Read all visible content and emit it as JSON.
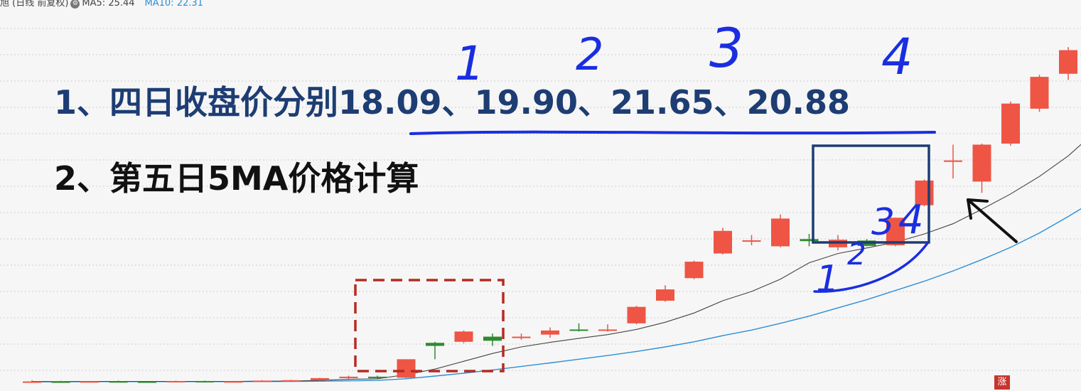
{
  "header": {
    "title_fragment": "旭 (日线 前复权)",
    "ma5_legend": "MA5: 25.44",
    "ma10_legend": "MA10: 22.31",
    "ma10_color": "#2b8fd6"
  },
  "annotations": {
    "line1": "1、四日收盘价分别18.09、19.90、21.65、20.88",
    "line2": "2、第五日5MA价格计算",
    "labels_top": [
      "1",
      "2",
      "3",
      "4"
    ],
    "labels_box": [
      "1",
      "2",
      "3",
      "4"
    ]
  },
  "badge": "涨",
  "colors": {
    "up": "#ee5544",
    "down": "#2f8a2f",
    "ma5": "#444444",
    "ma10": "#2b8fd6",
    "pen": "#1a2ee0",
    "frame_navy": "#1d3d73",
    "dash_red": "#b52b22"
  },
  "chart_data": {
    "type": "candlestick",
    "ylim": [
      10,
      28
    ],
    "grid": true,
    "candles": [
      {
        "o": 10.1,
        "h": 10.18,
        "l": 10.07,
        "c": 10.12
      },
      {
        "o": 10.12,
        "h": 10.15,
        "l": 10.09,
        "c": 10.1
      },
      {
        "o": 10.1,
        "h": 10.14,
        "l": 10.08,
        "c": 10.13
      },
      {
        "o": 10.13,
        "h": 10.16,
        "l": 10.1,
        "c": 10.12
      },
      {
        "o": 10.12,
        "h": 10.14,
        "l": 10.09,
        "c": 10.11
      },
      {
        "o": 10.11,
        "h": 10.16,
        "l": 10.09,
        "c": 10.14
      },
      {
        "o": 10.14,
        "h": 10.16,
        "l": 10.1,
        "c": 10.12
      },
      {
        "o": 10.12,
        "h": 10.15,
        "l": 10.1,
        "c": 10.13
      },
      {
        "o": 10.13,
        "h": 10.18,
        "l": 10.11,
        "c": 10.16
      },
      {
        "o": 10.16,
        "h": 10.2,
        "l": 10.14,
        "c": 10.18
      },
      {
        "o": 10.18,
        "h": 10.3,
        "l": 10.15,
        "c": 10.28
      },
      {
        "o": 10.28,
        "h": 10.4,
        "l": 10.24,
        "c": 10.35
      },
      {
        "o": 10.35,
        "h": 10.4,
        "l": 10.26,
        "c": 10.3
      },
      {
        "o": 10.3,
        "h": 11.2,
        "l": 10.28,
        "c": 11.2
      },
      {
        "o": 12.0,
        "h": 12.05,
        "l": 11.2,
        "c": 11.85
      },
      {
        "o": 12.05,
        "h": 12.6,
        "l": 11.98,
        "c": 12.55
      },
      {
        "o": 12.3,
        "h": 12.45,
        "l": 11.85,
        "c": 12.1
      },
      {
        "o": 12.3,
        "h": 12.45,
        "l": 12.15,
        "c": 12.3
      },
      {
        "o": 12.4,
        "h": 12.75,
        "l": 12.25,
        "c": 12.6
      },
      {
        "o": 12.65,
        "h": 12.95,
        "l": 12.55,
        "c": 12.62
      },
      {
        "o": 12.62,
        "h": 12.9,
        "l": 12.55,
        "c": 12.65
      },
      {
        "o": 12.95,
        "h": 13.8,
        "l": 12.9,
        "c": 13.75
      },
      {
        "o": 14.05,
        "h": 14.8,
        "l": 14.0,
        "c": 14.6
      },
      {
        "o": 15.15,
        "h": 16.0,
        "l": 15.1,
        "c": 15.95
      },
      {
        "o": 16.35,
        "h": 17.6,
        "l": 16.3,
        "c": 17.45
      },
      {
        "o": 16.99,
        "h": 17.25,
        "l": 16.75,
        "c": 16.99
      },
      {
        "o": 16.7,
        "h": 18.25,
        "l": 16.65,
        "c": 18.05
      },
      {
        "o": 17.05,
        "h": 17.3,
        "l": 16.7,
        "c": 16.95
      },
      {
        "o": 16.65,
        "h": 17.25,
        "l": 16.5,
        "c": 17.02
      },
      {
        "o": 16.98,
        "h": 17.05,
        "l": 16.7,
        "c": 16.72
      },
      {
        "o": 16.75,
        "h": 18.09,
        "l": 16.7,
        "c": 18.09
      },
      {
        "o": 18.7,
        "h": 19.95,
        "l": 18.65,
        "c": 19.9
      },
      {
        "o": 20.88,
        "h": 21.65,
        "l": 20.0,
        "c": 20.88
      },
      {
        "o": 19.85,
        "h": 21.7,
        "l": 19.3,
        "c": 21.65
      },
      {
        "o": 21.7,
        "h": 23.75,
        "l": 21.6,
        "c": 23.65
      },
      {
        "o": 23.4,
        "h": 25.05,
        "l": 23.25,
        "c": 24.95
      },
      {
        "o": 25.1,
        "h": 26.4,
        "l": 24.8,
        "c": 26.25
      },
      {
        "o": 26.15,
        "h": 28.0,
        "l": 25.85,
        "c": 27.9
      }
    ],
    "ma5": [
      10.12,
      10.11,
      10.12,
      10.12,
      10.12,
      10.12,
      10.12,
      10.12,
      10.13,
      10.14,
      10.17,
      10.22,
      10.25,
      10.45,
      10.72,
      11.1,
      11.48,
      11.8,
      12.02,
      12.22,
      12.4,
      12.65,
      13.0,
      13.45,
      14.05,
      14.5,
      15.1,
      15.9,
      16.35,
      16.62,
      16.9,
      17.3,
      17.8,
      18.5,
      19.25,
      20.1,
      21.1,
      22.35
    ],
    "ma10": [
      10.1,
      10.1,
      10.11,
      10.11,
      10.11,
      10.11,
      10.11,
      10.11,
      10.12,
      10.12,
      10.13,
      10.15,
      10.17,
      10.25,
      10.38,
      10.52,
      10.68,
      10.85,
      11.02,
      11.2,
      11.38,
      11.58,
      11.8,
      12.05,
      12.35,
      12.62,
      12.95,
      13.3,
      13.7,
      14.1,
      14.55,
      15.0,
      15.5,
      16.05,
      16.65,
      17.35,
      18.15,
      19.0
    ]
  }
}
